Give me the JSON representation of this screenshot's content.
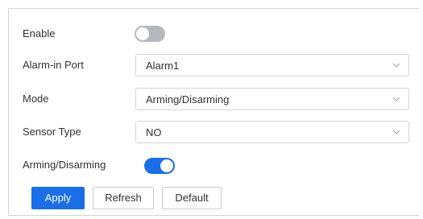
{
  "form": {
    "enable": {
      "label": "Enable",
      "state": "off"
    },
    "alarm_in_port": {
      "label": "Alarm-in Port",
      "value": "Alarm1"
    },
    "mode": {
      "label": "Mode",
      "value": "Arming/Disarming"
    },
    "sensor_type": {
      "label": "Sensor Type",
      "value": "NO"
    },
    "arming_disarming": {
      "label": "Arming/Disarming",
      "state": "on"
    }
  },
  "buttons": {
    "apply": "Apply",
    "refresh": "Refresh",
    "default": "Default"
  },
  "colors": {
    "accent": "#1a6fe8",
    "toggle_off": "#b5b8bd",
    "border": "#d2d5da"
  },
  "icons": {
    "dropdown": "chevron-down-icon"
  }
}
